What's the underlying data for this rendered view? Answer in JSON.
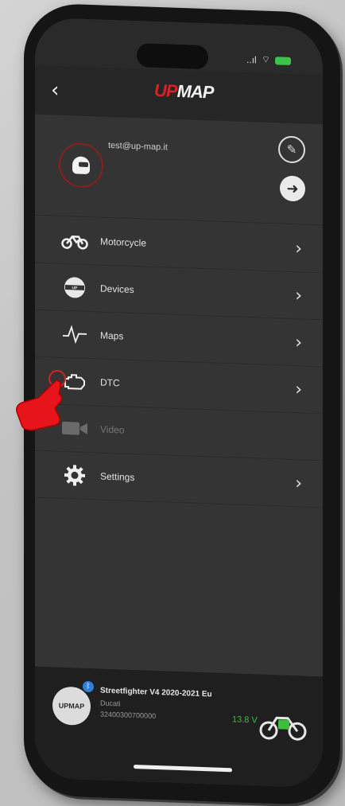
{
  "app": {
    "logo_part1": "UP",
    "logo_part2": "MAP"
  },
  "status": {
    "signal": "..ıl",
    "wifi": "wifi-icon",
    "battery": "battery-icon"
  },
  "profile": {
    "email": "test@up-map.it"
  },
  "menu": {
    "items": [
      {
        "label": "Motorcycle",
        "icon": "motorcycle-icon",
        "enabled": true
      },
      {
        "label": "Devices",
        "icon": "upmap-device-icon",
        "enabled": true
      },
      {
        "label": "Maps",
        "icon": "waveform-icon",
        "enabled": true
      },
      {
        "label": "DTC",
        "icon": "engine-icon",
        "enabled": true
      },
      {
        "label": "Video",
        "icon": "camera-icon",
        "enabled": false
      },
      {
        "label": "Settings",
        "icon": "gear-icon",
        "enabled": true
      }
    ]
  },
  "vehicle": {
    "name": "Streetfighter V4 2020-2021 Eu",
    "brand": "Ducati",
    "serial": "32400300700000",
    "voltage": "13.8 V",
    "connected_color": "#3cbf3c"
  },
  "colors": {
    "accent": "#d62222",
    "background": "#343434"
  }
}
